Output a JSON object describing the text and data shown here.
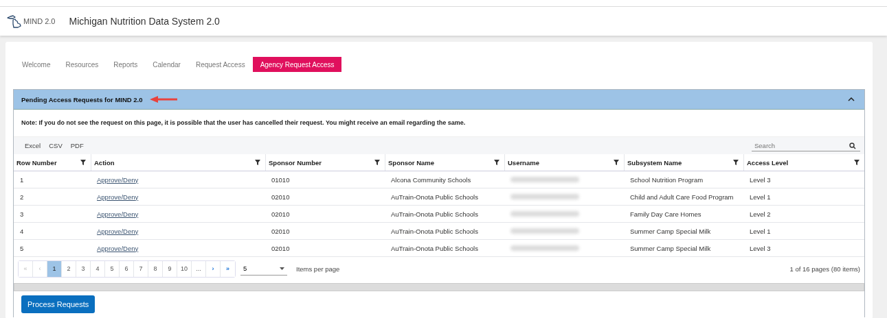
{
  "header": {
    "logo_text": "MIND 2.0",
    "title": "Michigan Nutrition Data System 2.0"
  },
  "tabs": [
    {
      "label": "Welcome",
      "selected": false
    },
    {
      "label": "Resources",
      "selected": false
    },
    {
      "label": "Reports",
      "selected": false
    },
    {
      "label": "Calendar",
      "selected": false
    },
    {
      "label": "Request Access",
      "selected": false
    },
    {
      "label": "Agency Request Access",
      "selected": true
    }
  ],
  "panel": {
    "title": "Pending Access Requests for MIND 2.0",
    "expanded": true,
    "note": "Note: If you do not see the request on this page, it is possible that the user has cancelled their request. You might receive an email regarding the same."
  },
  "toolbar": {
    "exports": [
      "Excel",
      "CSV",
      "PDF"
    ],
    "search": {
      "placeholder": "Search"
    }
  },
  "table": {
    "columns": [
      "Row Number",
      "Action",
      "Sponsor Number",
      "Sponsor Name",
      "Username",
      "Subsystem Name",
      "Access Level"
    ],
    "rows": [
      {
        "row_number": "1",
        "action": "Approve/Deny",
        "sponsor_number": "01010",
        "sponsor_name": "Alcona Community Schools",
        "subsystem_name": "School Nutrition Program",
        "access_level": "Level 3"
      },
      {
        "row_number": "2",
        "action": "Approve/Deny",
        "sponsor_number": "02010",
        "sponsor_name": "AuTrain-Onota Public Schools",
        "subsystem_name": "Child and Adult Care Food Program",
        "access_level": "Level 1"
      },
      {
        "row_number": "3",
        "action": "Approve/Deny",
        "sponsor_number": "02010",
        "sponsor_name": "AuTrain-Onota Public Schools",
        "subsystem_name": "Family Day Care Homes",
        "access_level": "Level 2"
      },
      {
        "row_number": "4",
        "action": "Approve/Deny",
        "sponsor_number": "02010",
        "sponsor_name": "AuTrain-Onota Public Schools",
        "subsystem_name": "Summer Camp Special Milk",
        "access_level": "Level 1"
      },
      {
        "row_number": "5",
        "action": "Approve/Deny",
        "sponsor_number": "02010",
        "sponsor_name": "AuTrain-Onota Public Schools",
        "subsystem_name": "Summer Camp Special Milk",
        "access_level": "Level 3"
      }
    ]
  },
  "pager": {
    "first": "«",
    "previous": "‹",
    "pages": [
      {
        "label": "1",
        "selected": true
      },
      {
        "label": "2",
        "selected": false
      },
      {
        "label": "3",
        "selected": false
      },
      {
        "label": "4",
        "selected": false
      },
      {
        "label": "5",
        "selected": false
      },
      {
        "label": "6",
        "selected": false
      },
      {
        "label": "7",
        "selected": false
      },
      {
        "label": "8",
        "selected": false
      },
      {
        "label": "9",
        "selected": false
      },
      {
        "label": "10",
        "selected": false
      },
      {
        "label": "...",
        "selected": false
      }
    ],
    "next": "›",
    "last": "»",
    "page_size": "5",
    "page_size_label": "Items per page",
    "summary": "1 of 16 pages (80 items)"
  },
  "process_button": "Process Requests"
}
